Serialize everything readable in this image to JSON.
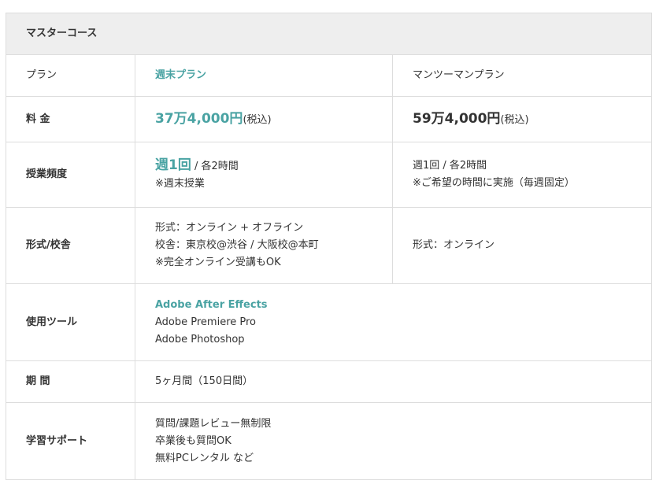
{
  "title": "マスターコース",
  "rows": {
    "plan": {
      "label": "プラン",
      "col1": "週末プラン",
      "col2": "マンツーマンプラン"
    },
    "price": {
      "label": "料 金",
      "col1_amount": "37万4,000円",
      "col1_tax": "(税込)",
      "col2_amount": "59万4,000円",
      "col2_tax": "(税込)"
    },
    "frequency": {
      "label": "授業頻度",
      "col1_main": "週1回",
      "col1_sub": " / 各2時間",
      "col1_note": "※週末授業",
      "col2_line1": "週1回 / 各2時間",
      "col2_line2": "※ご希望の時間に実施（毎週固定）"
    },
    "format": {
      "label": "形式/校舎",
      "col1_line1": "形式：オンライン + オフライン",
      "col1_line2": "校舎：東京校@渋谷 / 大阪校@本町",
      "col1_line3": "※完全オンライン受講もOK",
      "col2": "形式：オンライン"
    },
    "tools": {
      "label": "使用ツール",
      "items": [
        "Adobe After Effects",
        "Adobe Premiere Pro",
        "Adobe Photoshop"
      ]
    },
    "period": {
      "label": "期 間",
      "value": "5ヶ月間（150日間）"
    },
    "support": {
      "label": "学習サポート",
      "items": [
        "質問/課題レビュー無制限",
        "卒業後も質問OK",
        "無料PCレンタル など"
      ]
    }
  },
  "colors": {
    "accent": "#4aa3a3",
    "header_bg": "#eeeeee",
    "border": "#dddddd",
    "text": "#333333"
  }
}
